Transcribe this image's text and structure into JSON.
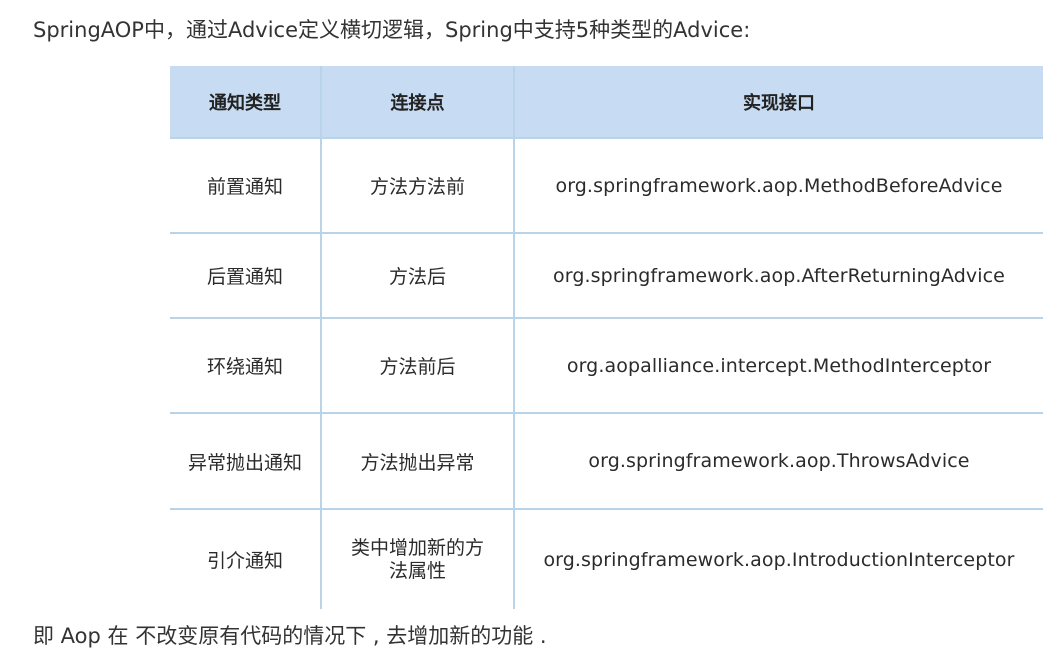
{
  "intro": "SpringAOP中，通过Advice定义横切逻辑，Spring中支持5种类型的Advice:",
  "table": {
    "headers": [
      "通知类型",
      "连接点",
      "实现接口"
    ],
    "rows": [
      [
        "前置通知",
        "方法方法前",
        "org.springframework.aop.MethodBeforeAdvice"
      ],
      [
        "后置通知",
        "方法后",
        "org.springframework.aop.AfterReturningAdvice"
      ],
      [
        "环绕通知",
        "方法前后",
        "org.aopalliance.intercept.MethodInterceptor"
      ],
      [
        "异常抛出通知",
        "方法抛出异常",
        "org.springframework.aop.ThrowsAdvice"
      ],
      [
        "引介通知",
        "类中增加新的方法属性",
        "org.springframework.aop.IntroductionInterceptor"
      ]
    ]
  },
  "outro": "即 Aop 在 不改变原有代码的情况下 , 去增加新的功能 .",
  "colors": {
    "header_bg": "#c7dcf2",
    "border": "#b9d3e9",
    "text": "#333333"
  }
}
